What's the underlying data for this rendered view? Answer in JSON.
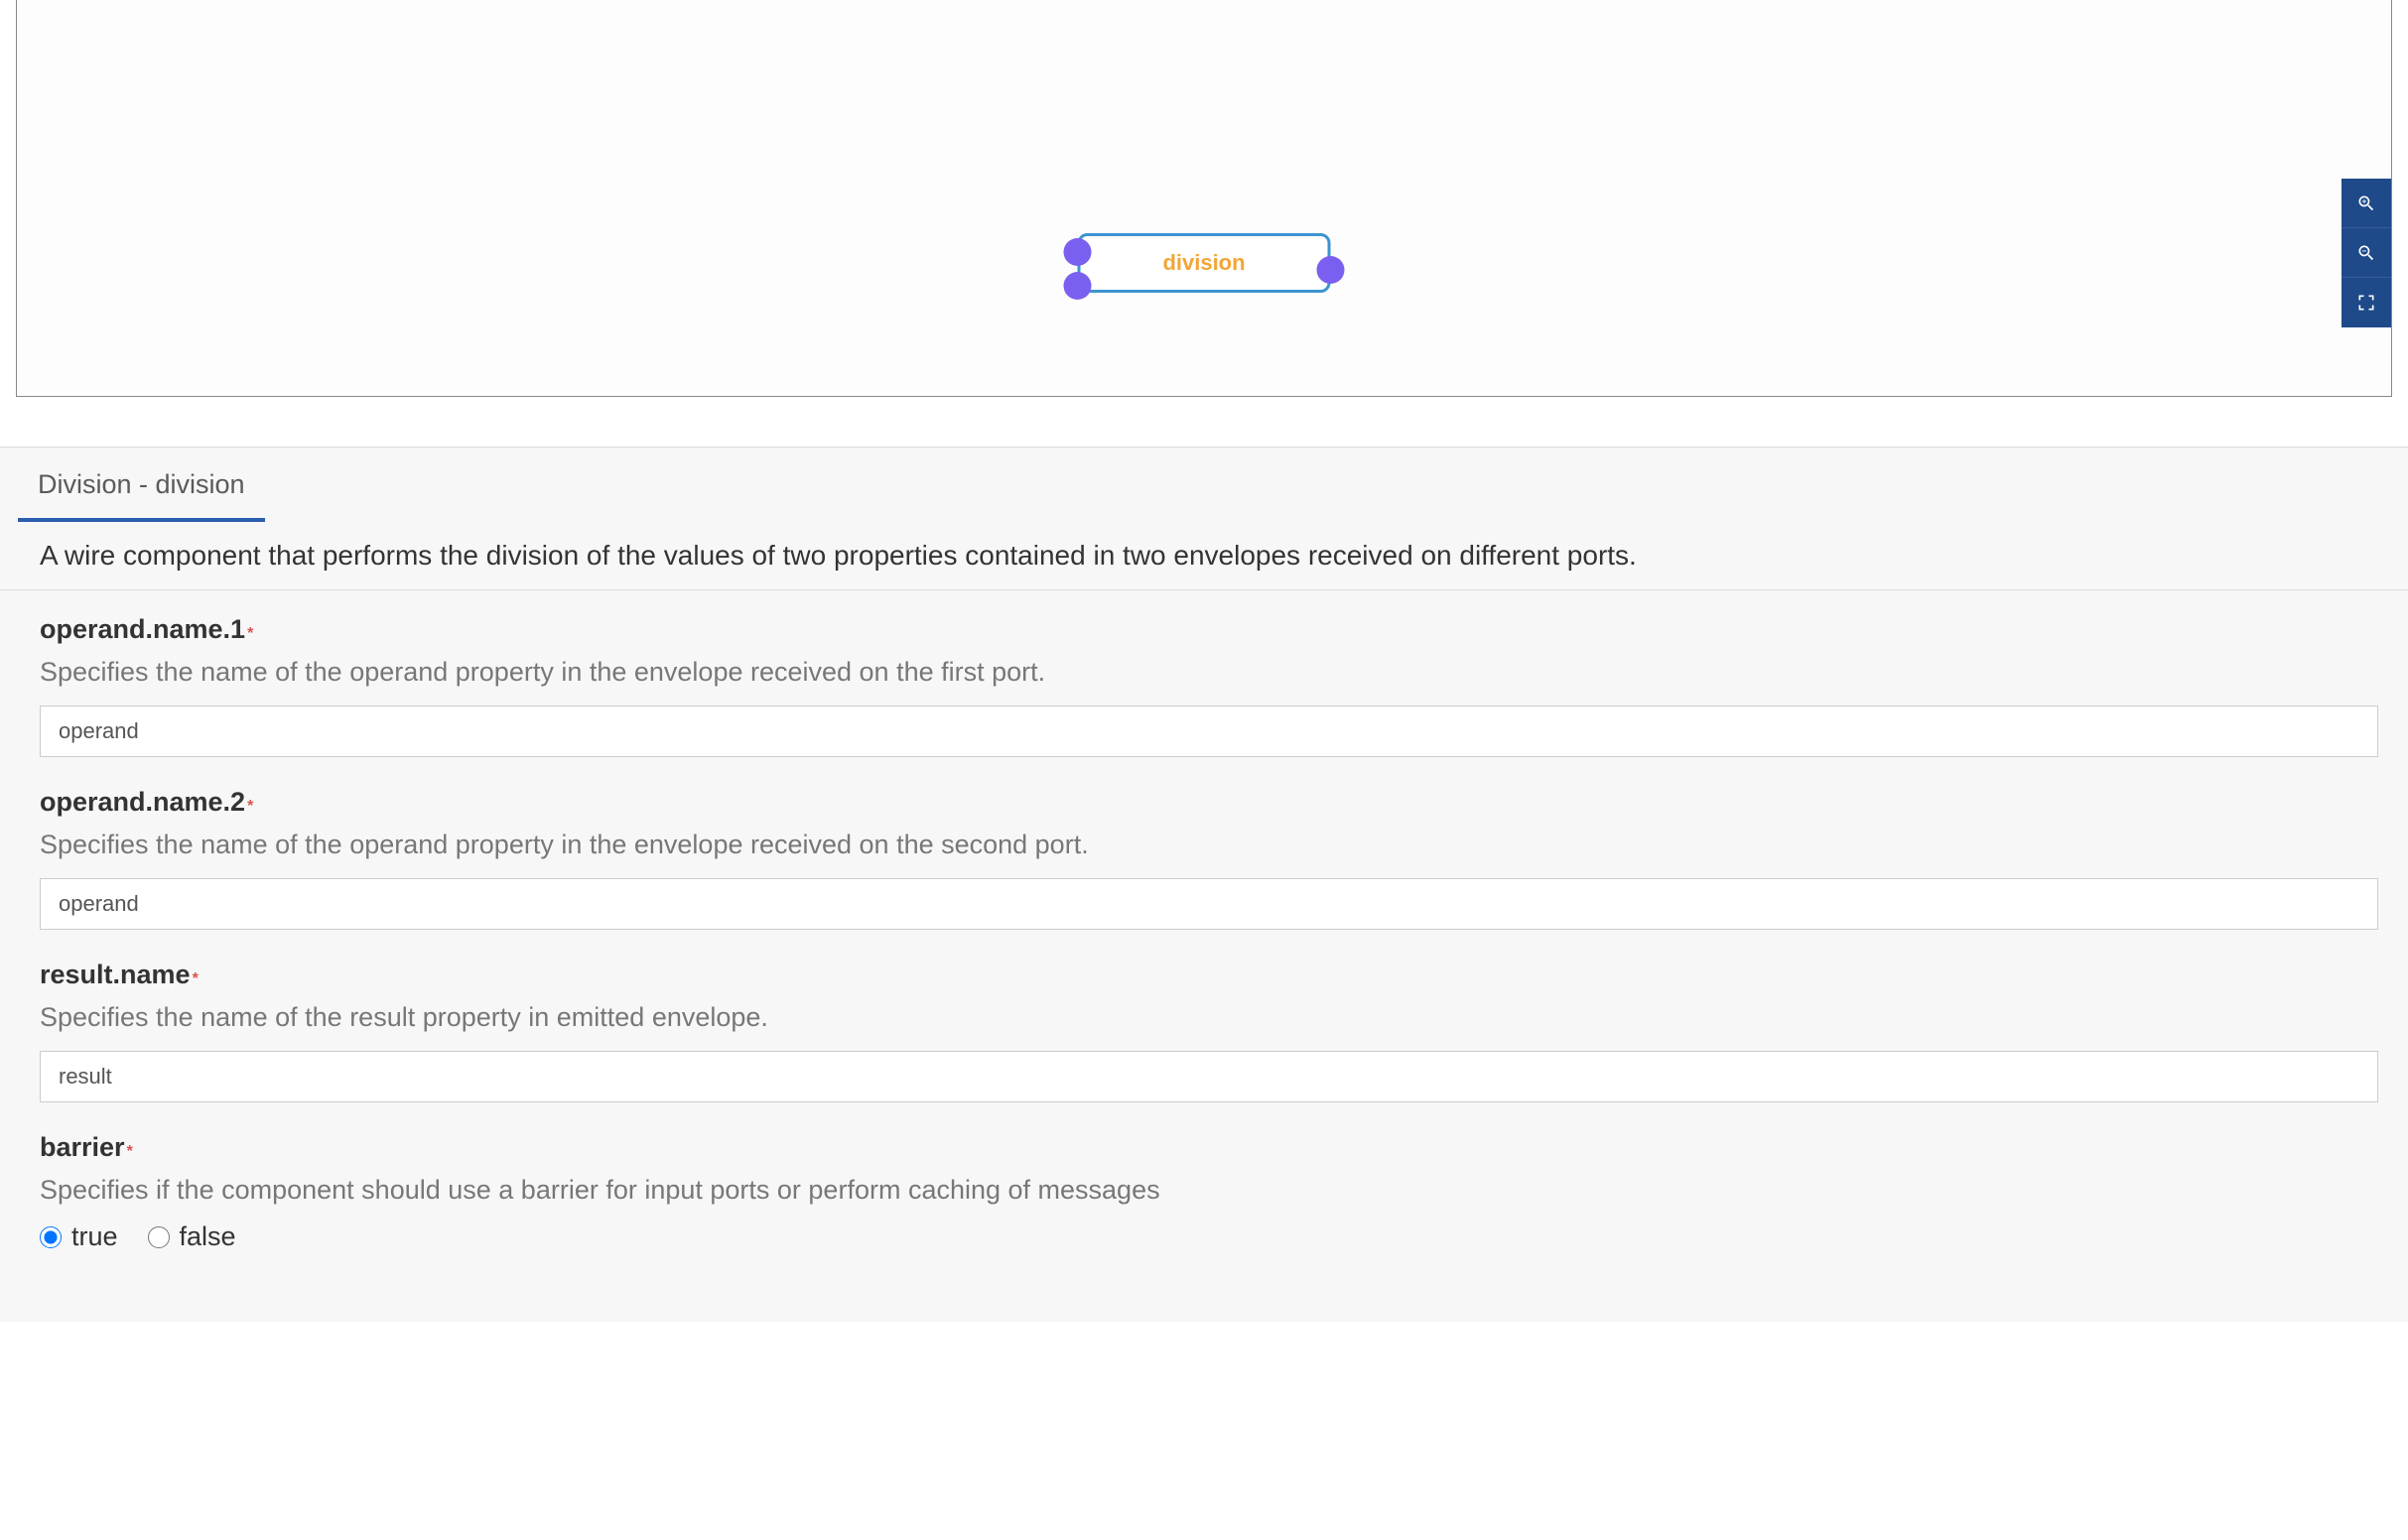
{
  "canvas": {
    "node_label": "division"
  },
  "panel": {
    "tab_label": "Division - division",
    "description": "A wire component that performs the division of the values of two properties contained in two envelopes received on different ports.",
    "fields": {
      "operand1": {
        "label": "operand.name.1",
        "required": "*",
        "help": "Specifies the name of the operand property in the envelope received on the first port.",
        "value": "operand"
      },
      "operand2": {
        "label": "operand.name.2",
        "required": "*",
        "help": "Specifies the name of the operand property in the envelope received on the second port.",
        "value": "operand"
      },
      "result": {
        "label": "result.name",
        "required": "*",
        "help": "Specifies the name of the result property in emitted envelope.",
        "value": "result"
      },
      "barrier": {
        "label": "barrier",
        "required": "*",
        "help": "Specifies if the component should use a barrier for input ports or perform caching of messages",
        "option_true": "true",
        "option_false": "false"
      }
    }
  }
}
